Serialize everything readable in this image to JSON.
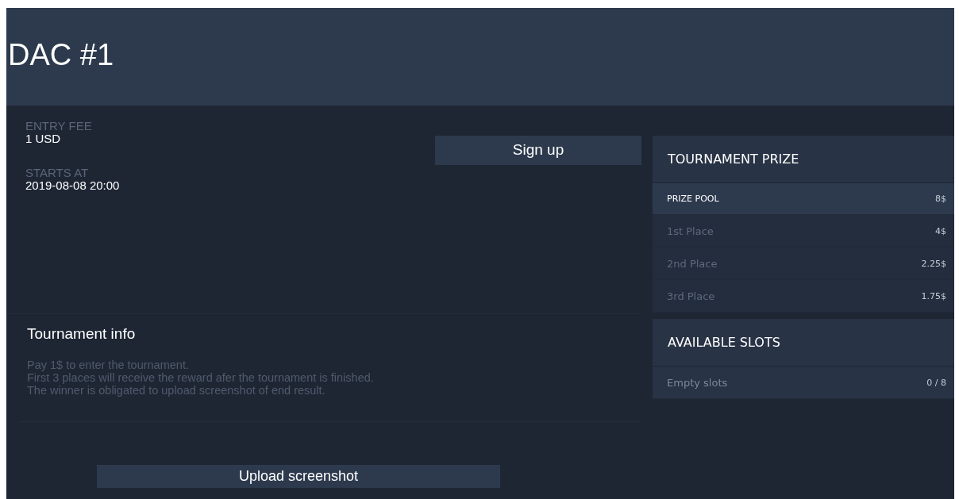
{
  "title": "DAC #1",
  "details": [
    {
      "label": "ENTRY FEE",
      "value": "1 USD"
    },
    {
      "label": "STARTS AT",
      "value": "2019-08-08 20:00"
    }
  ],
  "sign_up_button": "Sign up",
  "info": {
    "heading": "Tournament info",
    "lines": [
      "Pay 1$ to enter the tournament.",
      "First 3 places will receive the reward afer the tournament is finished.",
      "The winner is obligated to upload screenshot of end result."
    ]
  },
  "upload_button": "Upload screenshot",
  "prize": {
    "title": "TOURNAMENT PRIZE",
    "rows": [
      {
        "kind": "total",
        "label": "PRIZE POOL",
        "value": "8$"
      },
      {
        "kind": "place",
        "label": "1st Place",
        "value": "4$"
      },
      {
        "kind": "place",
        "label": "2nd Place",
        "value": "2.25$"
      },
      {
        "kind": "place",
        "label": "3rd Place",
        "value": "1.75$"
      }
    ]
  },
  "slots": {
    "title": "AVAILABLE SLOTS",
    "rows": [
      {
        "label": "Empty slots",
        "value": "0 / 8"
      }
    ]
  }
}
